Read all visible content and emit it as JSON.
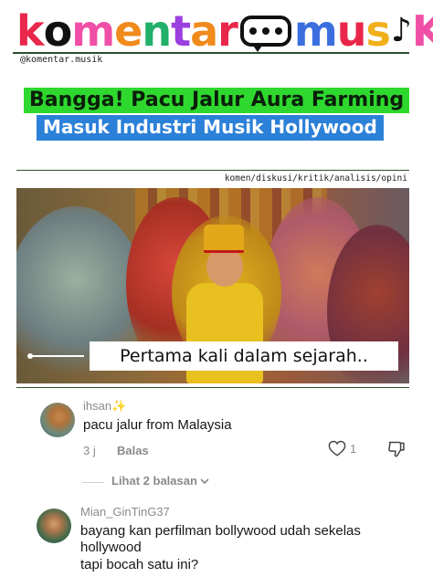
{
  "brand": {
    "logo_letters": [
      {
        "ch": "k",
        "color": "#e8274a"
      },
      {
        "ch": "o",
        "color": "#111111"
      },
      {
        "ch": "m",
        "color": "#ef4fa6"
      },
      {
        "ch": "e",
        "color": "#f08a1c"
      },
      {
        "ch": "n",
        "color": "#20b06a"
      },
      {
        "ch": "t",
        "color": "#9b3fe0"
      },
      {
        "ch": "a",
        "color": "#f08a1c"
      },
      {
        "ch": "r",
        "color": "#e8274a"
      }
    ],
    "logo_letters_2": [
      {
        "ch": "m",
        "color": "#3b6fe0"
      },
      {
        "ch": "u",
        "color": "#e8274a"
      },
      {
        "ch": "s",
        "color": "#f0b01c"
      }
    ],
    "logo_letters_3": [
      {
        "ch": "K",
        "color": "#ef4fa6"
      }
    ],
    "handle": "@komentar.musik"
  },
  "headline": {
    "line1": "Bangga! Pacu Jalur Aura Farming",
    "line2": "Masuk Industri Musik Hollywood"
  },
  "tags": "komen/diskusi/kritik/analisis/opini",
  "video": {
    "caption": "Pertama kali dalam sejarah.."
  },
  "comments": [
    {
      "user": "ihsan✨",
      "text": "pacu jalur from Malaysia",
      "time": "3 j",
      "reply_label": "Balas",
      "likes": "1",
      "view_replies": "Lihat 2 balasan"
    },
    {
      "user": "Mian_GinTinG37",
      "text": "bayang kan perfilman bollywood udah sekelas hollywood",
      "text2": "tapi bocah satu ini?"
    }
  ]
}
